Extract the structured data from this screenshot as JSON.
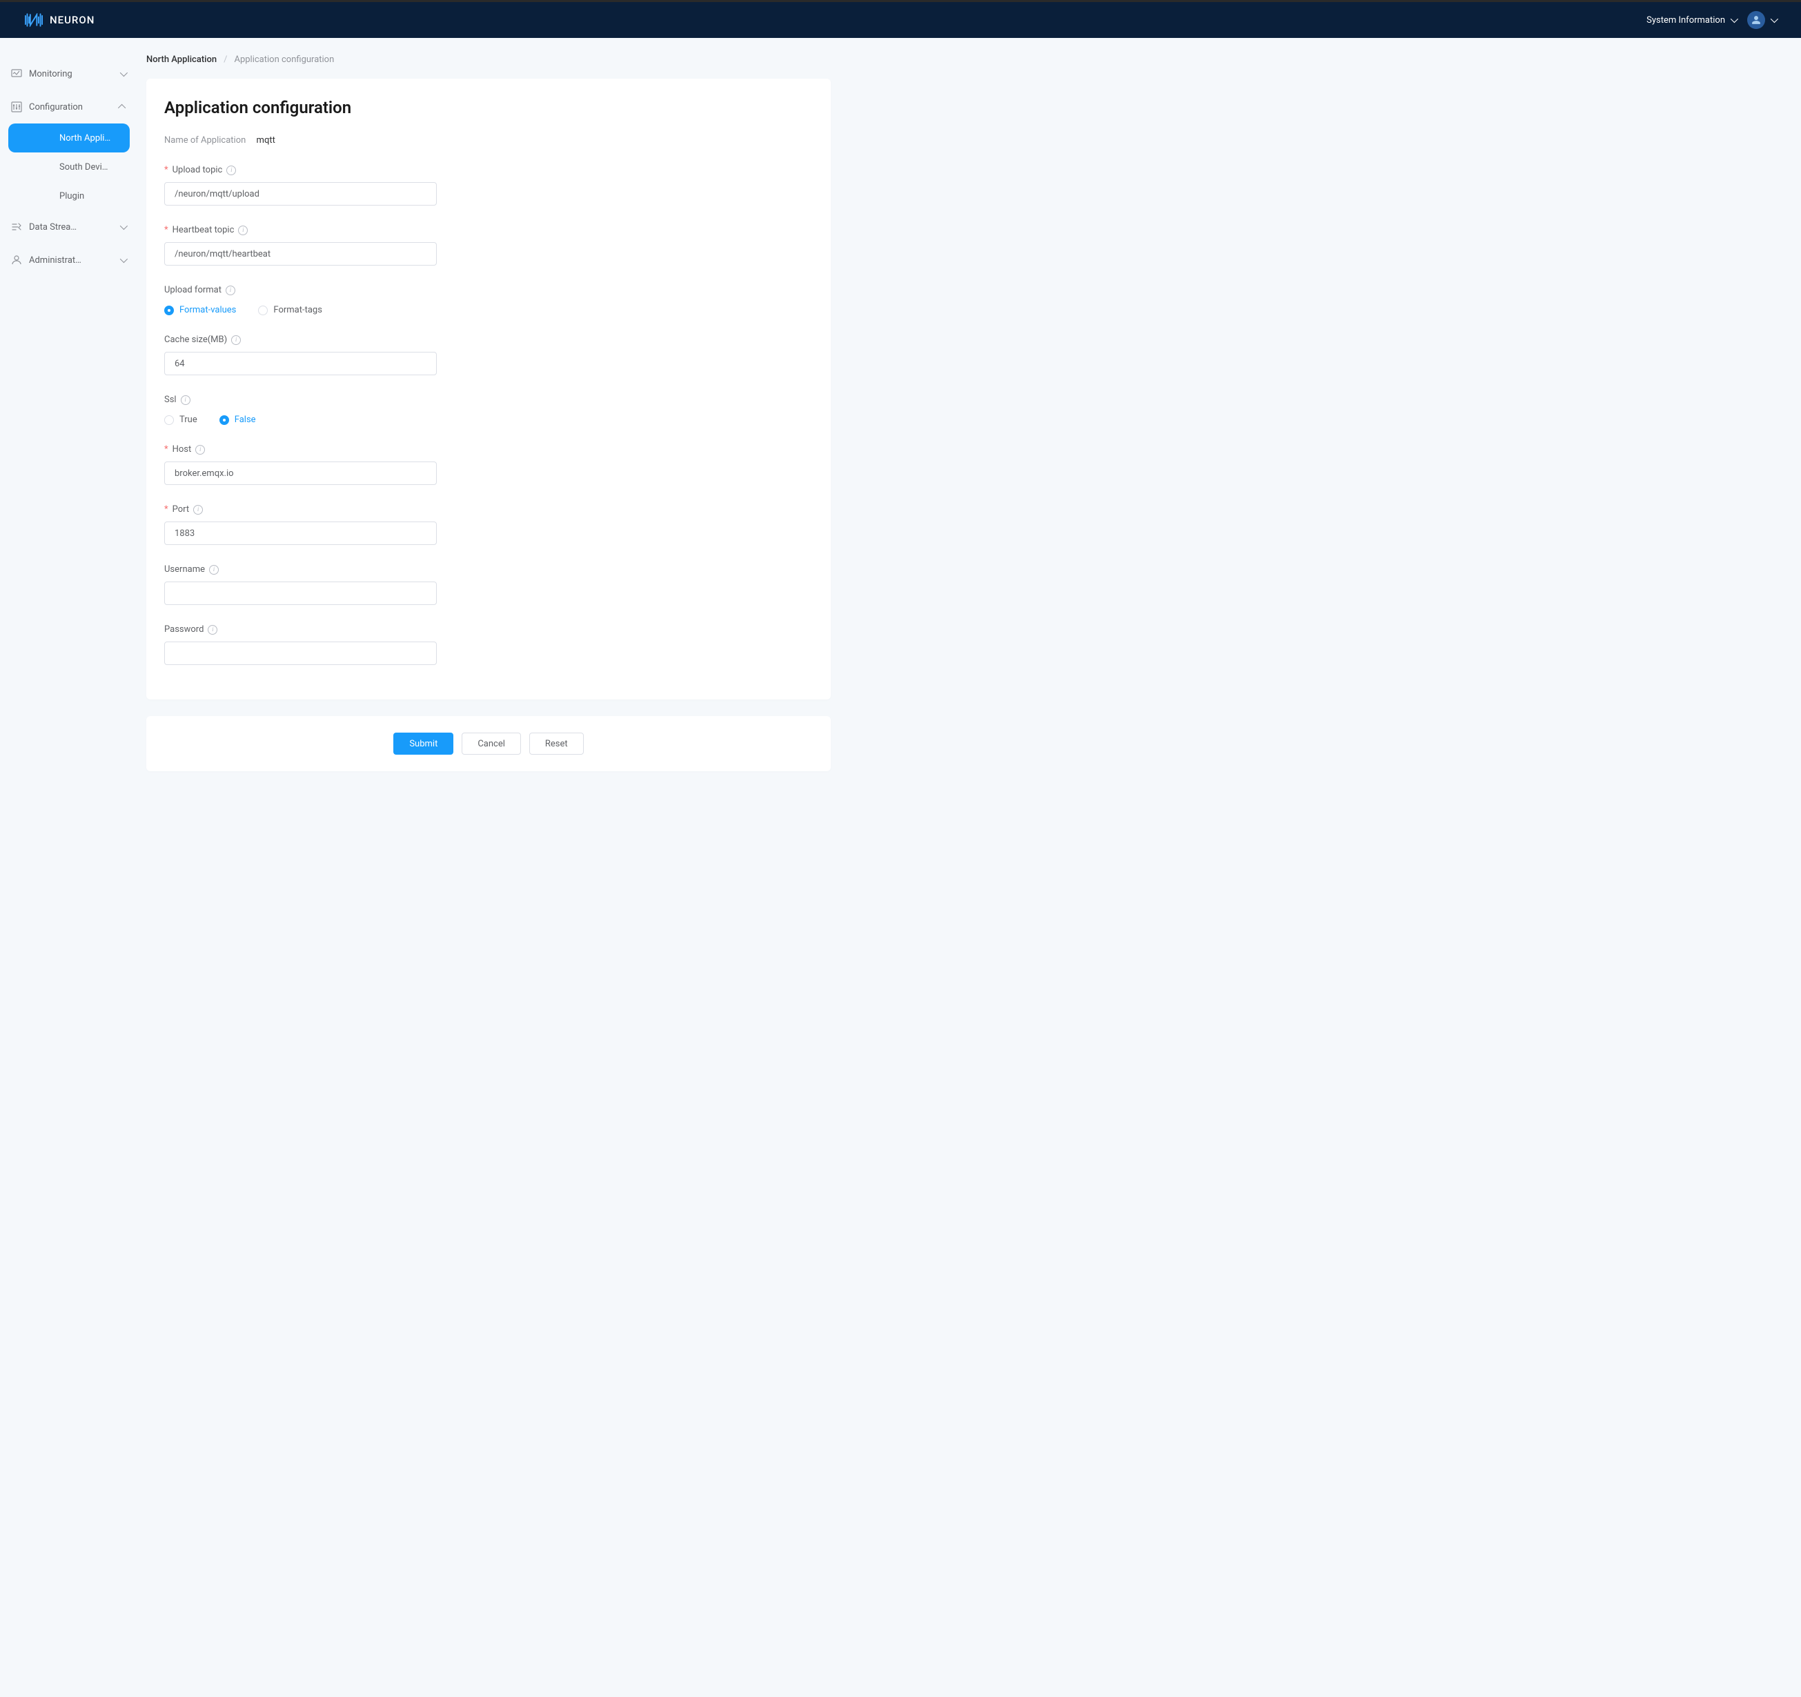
{
  "header": {
    "brand": "NEURON",
    "sysInfo": "System Information"
  },
  "sidebar": {
    "monitoring": "Monitoring",
    "configuration": "Configuration",
    "northApp": "North Appli…",
    "southDev": "South Devi…",
    "plugin": "Plugin",
    "dataStream": "Data Strea…",
    "administration": "Administrat…"
  },
  "breadcrumb": {
    "item1": "North Application",
    "item2": "Application configuration"
  },
  "page": {
    "title": "Application configuration",
    "nameLabel": "Name of Application",
    "nameValue": "mqtt"
  },
  "form": {
    "uploadTopic": {
      "label": "Upload topic",
      "value": "/neuron/mqtt/upload",
      "required": true
    },
    "heartbeatTopic": {
      "label": "Heartbeat topic",
      "value": "/neuron/mqtt/heartbeat",
      "required": true
    },
    "uploadFormat": {
      "label": "Upload format",
      "opt1": "Format-values",
      "opt2": "Format-tags",
      "selected": "Format-values"
    },
    "cacheSize": {
      "label": "Cache size(MB)",
      "value": "64"
    },
    "ssl": {
      "label": "Ssl",
      "opt1": "True",
      "opt2": "False",
      "selected": "False"
    },
    "host": {
      "label": "Host",
      "value": "broker.emqx.io",
      "required": true
    },
    "port": {
      "label": "Port",
      "value": "1883",
      "required": true
    },
    "username": {
      "label": "Username",
      "value": ""
    },
    "password": {
      "label": "Password",
      "value": ""
    }
  },
  "buttons": {
    "submit": "Submit",
    "cancel": "Cancel",
    "reset": "Reset"
  }
}
